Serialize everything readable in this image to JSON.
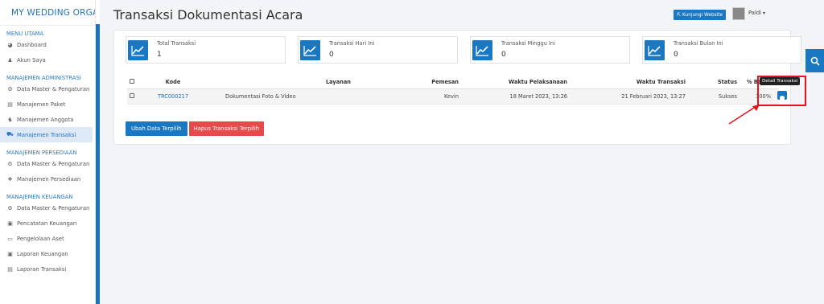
{
  "sidebar": {
    "brand": "MY WEDDING ORGAN",
    "sections": [
      {
        "title": "MENU UTAMA",
        "items": [
          {
            "label": "Dashboard",
            "icon": "dashboard-icon"
          },
          {
            "label": "Akun Saya",
            "icon": "user-icon"
          }
        ]
      },
      {
        "title": "MANAJEMEN ADMINISTRASI",
        "items": [
          {
            "label": "Data Master & Pengaturan",
            "icon": "gears-icon"
          },
          {
            "label": "Manajemen Paket",
            "icon": "book-icon"
          },
          {
            "label": "Manajemen Anggota",
            "icon": "users-icon"
          },
          {
            "label": "Manajemen Transaksi",
            "icon": "cart-icon",
            "active": true
          }
        ]
      },
      {
        "title": "MANAJEMEN PERSEDIAAN",
        "items": [
          {
            "label": "Data Master & Pengaturan",
            "icon": "gears-icon"
          },
          {
            "label": "Manajemen Persediaan",
            "icon": "boxes-icon"
          }
        ]
      },
      {
        "title": "MANAJEMEN KEUANGAN",
        "items": [
          {
            "label": "Data Master & Pengaturan",
            "icon": "gears-icon"
          },
          {
            "label": "Pencatatan Keuangan",
            "icon": "money-icon"
          },
          {
            "label": "Pengelolaan Aset",
            "icon": "laptop-icon"
          },
          {
            "label": "Laporan Keuangan",
            "icon": "money-icon"
          },
          {
            "label": "Laporan Transaksi",
            "icon": "book-icon"
          }
        ]
      }
    ]
  },
  "header": {
    "title": "Transaksi Dokumentasi Acara",
    "visit_button": "Kunjungi Website",
    "user_name": "Paldi"
  },
  "stats": [
    {
      "label": "Total Transaksi",
      "value": "1"
    },
    {
      "label": "Transaksi Hari Ini",
      "value": "0"
    },
    {
      "label": "Transaksi Minggu Ini",
      "value": "0"
    },
    {
      "label": "Transaksi Bulan Ini",
      "value": "0"
    }
  ],
  "table": {
    "headers": [
      "Kode",
      "Layanan",
      "Pemesan",
      "Waktu Pelaksanaan",
      "Waktu Transaksi",
      "Status",
      "% Bayar"
    ],
    "rows": [
      {
        "kode": "TRC000217",
        "layanan": "Dokumentasi Foto & Video",
        "pemesan": "Kevin",
        "waktu_pelaksanaan": "18 Maret 2023, 13:26",
        "waktu_transaksi": "21 Februari 2023, 13:27",
        "status": "Sukses",
        "bayar": "100%"
      }
    ]
  },
  "actions": {
    "update": "Ubah Data Terpilih",
    "delete": "Hapus Transaksi Terpilih"
  },
  "tooltip": "Detail Transaksi",
  "colors": {
    "primary": "#1a78c2",
    "danger": "#e74a4a",
    "highlight": "#e3141c"
  }
}
